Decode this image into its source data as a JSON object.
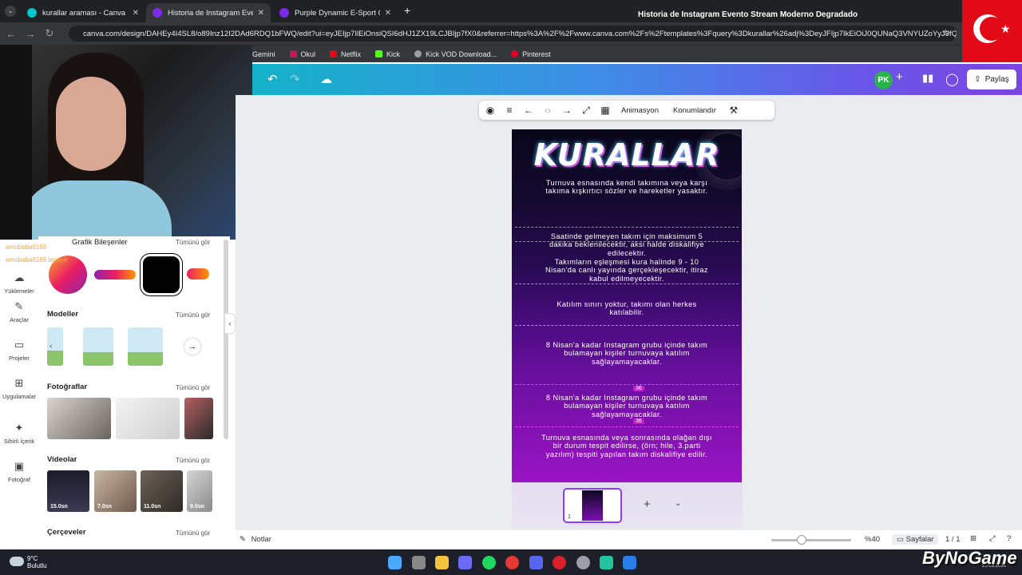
{
  "browser": {
    "tabs": [
      {
        "title": "kurallar araması - Canva",
        "color": "#00c4cc",
        "active": false
      },
      {
        "title": "Historia de Instagram Evento St...",
        "color": "#7d2ae8",
        "active": true
      },
      {
        "title": "Purple Dynamic E-Sport Game...",
        "color": "#7d2ae8",
        "active": false
      }
    ],
    "url": "canva.com/design/DAHEy4I4SL8/o89Inz12I2DAd6RDQ1bFWQ/edit?ui=eyJEIjp7IlEiOnsiQSI6dHJ1ZX19LCJBIjp7fX0&referrer=https%3A%2F%2Fwww.canva.com%2Fs%2Ftemplates%3Fquery%3Dkurallar%26adj%3DeyJFIjp7IkEiOiJ0QUNaQ3VNYUZoYyJ9fQ",
    "bookmarks": [
      {
        "label": "Gemini",
        "color": "#4f8bf9"
      },
      {
        "label": "Okul",
        "color": "#c2185b"
      },
      {
        "label": "Netflix",
        "color": "#e50914"
      },
      {
        "label": "Kick",
        "color": "#53fc18"
      },
      {
        "label": "Kick VOD Download...",
        "color": "#9aa0a6"
      },
      {
        "label": "Pinterest",
        "color": "#e60023"
      }
    ]
  },
  "header": {
    "doc_title": "Historia de Instagram Evento Stream Moderno Degradado ...",
    "avatar": "PK",
    "share_label": "Paylaş"
  },
  "context_toolbar": {
    "animate_label": "Animasyon",
    "position_label": "Konumlandır"
  },
  "rail": [
    {
      "label": "Yüklemeler",
      "icon": "upload-icon",
      "glyph": "☁"
    },
    {
      "label": "Araçlar",
      "icon": "tools-icon",
      "glyph": "✎"
    },
    {
      "label": "Projeler",
      "icon": "folder-icon",
      "glyph": "▭"
    },
    {
      "label": "Uygulamalar",
      "icon": "apps-icon",
      "glyph": "⊞"
    },
    {
      "label": "Sihirli İçerik",
      "icon": "magic-icon",
      "glyph": "✦"
    },
    {
      "label": "Fotoğraf",
      "icon": "photo-icon",
      "glyph": "▣"
    }
  ],
  "panel": {
    "elements_heading": "Grafik Bileşenler",
    "see_all": "Tümünü gör",
    "models_heading": "Modeller",
    "photos_heading": "Fotoğraflar",
    "videos_heading": "Videolar",
    "frames_heading": "Çerçeveler",
    "videos": [
      {
        "duration": "15.0sn"
      },
      {
        "duration": "7.0sn"
      },
      {
        "duration": "11.0sn"
      },
      {
        "duration": "9.0sn"
      }
    ]
  },
  "chat_overlay": {
    "user": "emobaba6169",
    "message": "tepeye"
  },
  "design": {
    "title": "KURALLAR",
    "rules": [
      "Turnuva esnasında kendi takımına veya karşı takıma kışkırtıcı sözler ve hareketler yasaktır.",
      "Saatinde gelmeyen takım için maksimum 5 dakika beklenilecektir, aksi halde diskalifiye edilecektir.",
      "Takımların eşleşmesi kura halinde 9 - 10 Nisan'da canlı yayında gerçekleşecektir, itiraz kabul edilmeyecektir.",
      "Katılım sınırı yoktur, takımı olan herkes katılabilir.",
      "8 Nisan'a kadar Instagram grubu içinde takım bulamayan kişiler turnuvaya katılım sağlayamayacaklar.",
      "8 Nisan'a kadar Instagram grubu içinde takım bulamayan kişiler turnuvaya katılım sağlayamayacaklar.",
      "Turnuva esnasında veya sonrasında olağan dışı bir durum tespit edilirse, (örn; hile, 3.parti yazılım) tespiti yapılan takım diskalifiye edilir."
    ],
    "spacing_badge": "36"
  },
  "bottom_bar": {
    "notes_label": "Notlar",
    "zoom": "%40",
    "zoom_level": 0.4,
    "pages_label": "Sayfalar",
    "page_count": "1 / 1",
    "page_number": "1"
  },
  "taskbar": {
    "temperature": "9°C",
    "weather": "Bulutlu",
    "date": "25.03.2026"
  },
  "watermark": "ByNoGame"
}
